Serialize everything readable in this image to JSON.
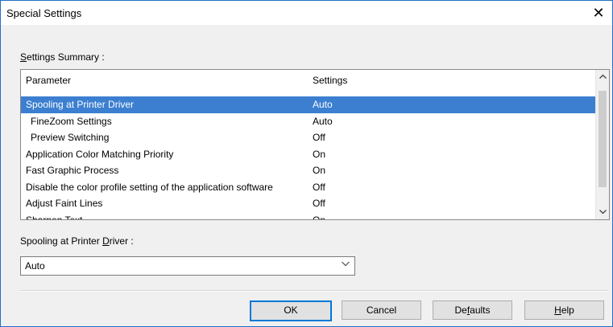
{
  "window": {
    "title": "Special Settings",
    "close_glyph": "✕"
  },
  "summary": {
    "label_access": "S",
    "label_rest": "ettings Summary :",
    "columns": {
      "parameter": "Parameter",
      "settings": "Settings"
    },
    "rows": [
      {
        "parameter": "Spooling at Printer Driver",
        "setting": "Auto",
        "selected": true
      },
      {
        "parameter": "FineZoom Settings",
        "setting": "Auto",
        "indent": true
      },
      {
        "parameter": "Preview Switching",
        "setting": "Off",
        "indent": true
      },
      {
        "parameter": "Application Color Matching Priority",
        "setting": "On"
      },
      {
        "parameter": "Fast Graphic Process",
        "setting": "On"
      },
      {
        "parameter": "Disable the color profile setting of the application software",
        "setting": "Off"
      },
      {
        "parameter": "Adjust Faint Lines",
        "setting": "Off"
      },
      {
        "parameter": "Sharpen Text",
        "setting": "On"
      }
    ],
    "scroll_up_icon": "chevron-up-icon",
    "scroll_down_icon": "chevron-down-icon"
  },
  "driver": {
    "label_before": "Spooling at Printer ",
    "label_access": "D",
    "label_after": "river :",
    "value": "Auto"
  },
  "buttons": {
    "ok": "OK",
    "cancel": "Cancel",
    "defaults_before": "De",
    "defaults_access": "f",
    "defaults_after": "aults",
    "help_access": "H",
    "help_after": "elp"
  },
  "colors": {
    "selection": "#3c7fd0",
    "window_border": "#1f6fc4",
    "default_button_border": "#0078d7"
  }
}
